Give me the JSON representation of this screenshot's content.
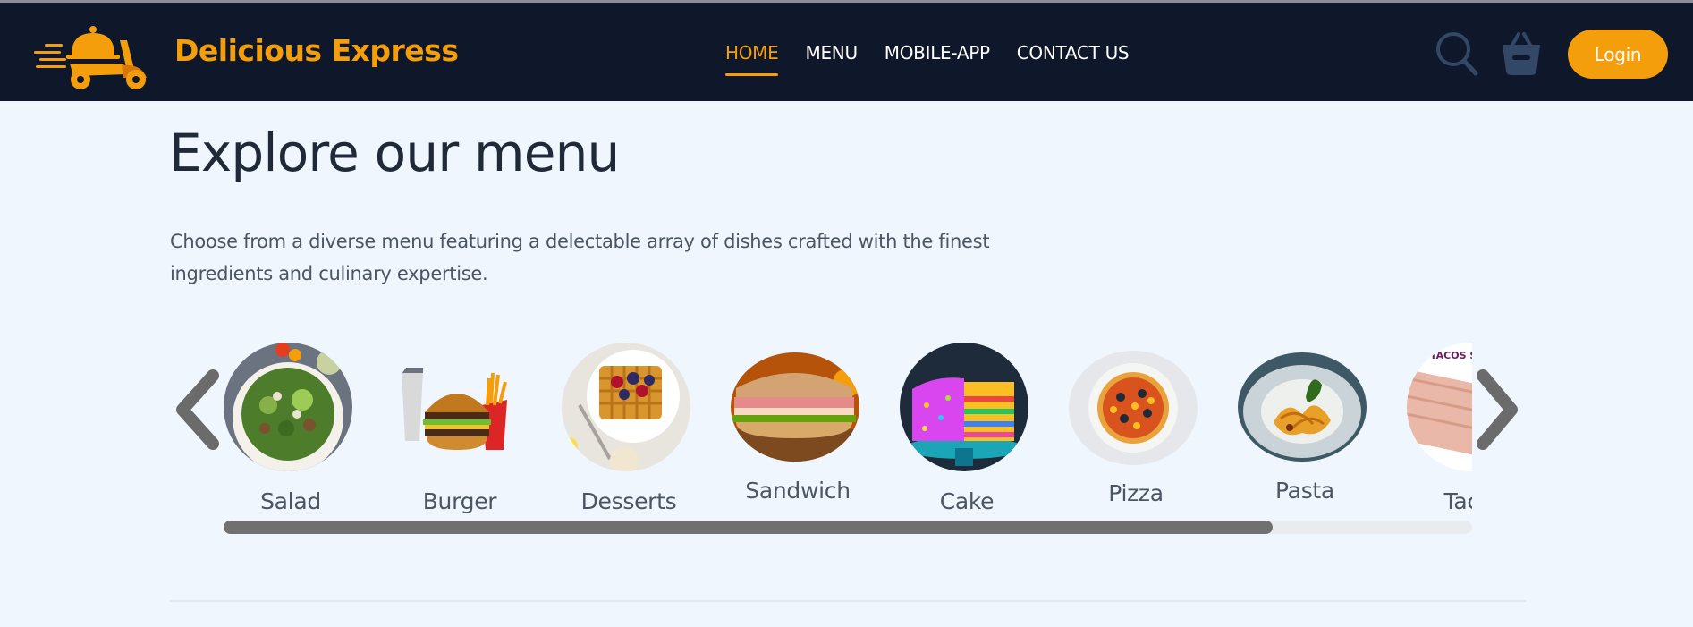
{
  "header": {
    "brand": "Delicious Express",
    "logo_icon": "delivery-scooter-icon",
    "nav": [
      {
        "label": "HOME",
        "active": true
      },
      {
        "label": "MENU",
        "active": false
      },
      {
        "label": "MOBILE-APP",
        "active": false
      },
      {
        "label": "CONTACT US",
        "active": false
      }
    ],
    "search_icon": "search-icon",
    "basket_icon": "basket-icon",
    "login_label": "Login"
  },
  "main": {
    "title": "Explore our menu",
    "description": "Choose from a diverse menu featuring a delectable array of dishes crafted with the finest ingredients and culinary expertise.",
    "menu_items": [
      {
        "label": "Salad"
      },
      {
        "label": "Burger"
      },
      {
        "label": "Desserts"
      },
      {
        "label": "Sandwich"
      },
      {
        "label": "Cake"
      },
      {
        "label": "Pizza"
      },
      {
        "label": "Pasta"
      },
      {
        "label": "Tacos"
      }
    ],
    "partial_image_text": "TACOS STE",
    "prev_icon": "chevron-left-icon",
    "next_icon": "chevron-right-icon",
    "scroll_fraction": 0.84
  },
  "colors": {
    "nav_bg": "#0f172a",
    "accent": "#f59e0b",
    "page_bg": "#eff6fe",
    "text_dark": "#1f2937",
    "text_muted": "#4b5563"
  }
}
